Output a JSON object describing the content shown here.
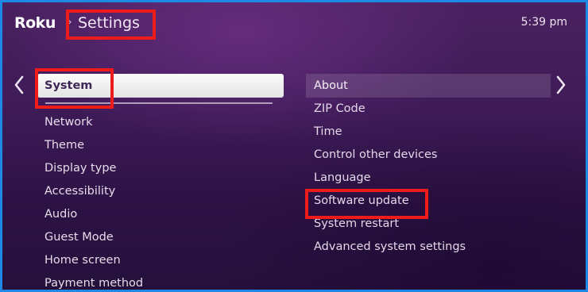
{
  "header": {
    "logo": "Roku",
    "breadcrumb_separator": "›",
    "title": "Settings",
    "clock": "5:39 pm"
  },
  "left_menu": {
    "items": [
      {
        "label": "System",
        "selected": true
      },
      {
        "label": "Network"
      },
      {
        "label": "Theme"
      },
      {
        "label": "Display type"
      },
      {
        "label": "Accessibility"
      },
      {
        "label": "Audio"
      },
      {
        "label": "Guest Mode"
      },
      {
        "label": "Home screen"
      },
      {
        "label": "Payment method"
      }
    ]
  },
  "right_menu": {
    "items": [
      {
        "label": "About",
        "active": true
      },
      {
        "label": "ZIP Code"
      },
      {
        "label": "Time"
      },
      {
        "label": "Control other devices"
      },
      {
        "label": "Language"
      },
      {
        "label": "Software update",
        "highlighted": true
      },
      {
        "label": "System restart"
      },
      {
        "label": "Advanced system settings"
      }
    ]
  },
  "icons": {
    "left": "chevron-left-icon",
    "right": "chevron-right-icon"
  },
  "colors": {
    "background": "#3f1b58",
    "selected_item": "#f2f2f2",
    "annotation_box": "#ee1b1b",
    "outer_border": "#1e88e5"
  }
}
